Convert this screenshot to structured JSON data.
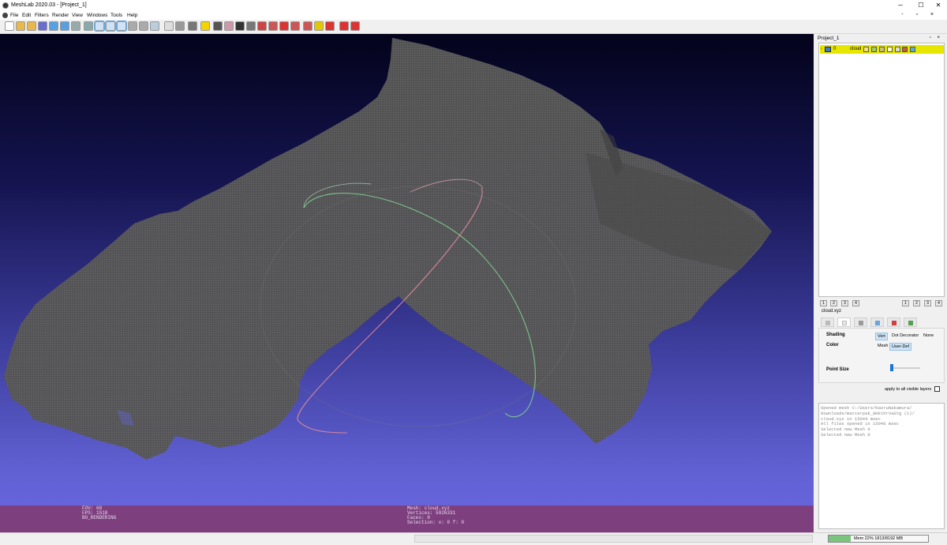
{
  "window": {
    "title": "MeshLab 2020.03 - [Project_1]",
    "minimize": "─",
    "maximize": "☐",
    "close": "✕"
  },
  "menu": {
    "items": [
      "File",
      "Edit",
      "Filters",
      "Render",
      "View",
      "Windows",
      "Tools",
      "Help"
    ],
    "mdi_controls": "- ▫ ×"
  },
  "toolbar_icons": [
    "new-project",
    "open-project",
    "save-project",
    "close-project",
    "import-mesh",
    "export-mesh",
    "reload",
    "snapshot",
    "bbox-mode",
    "points-mode",
    "wireframe-mode",
    "flat-mode",
    "smooth-mode",
    "texture-mode",
    "layers",
    "decorations",
    "trackball",
    "measure",
    "pick-points",
    "manipulators",
    "paint",
    "select-faces",
    "select-vertices",
    "select-connected",
    "delete-faces",
    "delete-vertices",
    "align",
    "info",
    "delete-selected-faces",
    "delete-selected-vertices",
    "delete-selected"
  ],
  "status_left": [
    "FOV: 60",
    "FPS:   1518",
    "BO_RENDERING"
  ],
  "status_center": [
    "Mesh: cloud.xyz",
    "Vertices: 5926331",
    "Faces: 0",
    "Selection: v: 0 f: 0"
  ],
  "panel": {
    "title": "Project_1",
    "controls": "▫ ×",
    "layer": {
      "number": "0",
      "name": "cloud"
    },
    "snap_left": [
      "1",
      "2",
      "3",
      "4"
    ],
    "snap_right": [
      "1",
      "2",
      "3",
      "4"
    ],
    "mesh_file": "cloud.xyz",
    "render": {
      "shading_label": "Shading",
      "shading_options": [
        "Vert",
        "Dot Decorator",
        "None"
      ],
      "color_label": "Color",
      "color_options": [
        "Mesh",
        "User-Def"
      ],
      "point_size_label": "Point Size",
      "point_size_level": 0.05,
      "apply_label": "apply to all visible layers"
    }
  },
  "log": [
    "Opened mesh C:/Users/KaoruNakamura/",
    "Downloads/matterpak_9mkthrVaGYg (1)/",
    "cloud.xyz in 15044 msec",
    "All files opened in 15046 msec",
    "Selected new Mesh 0",
    "Selected new Mesh 0"
  ],
  "memory": {
    "label": "Mem 22% 1813/8192 MB",
    "fraction": 0.22
  },
  "colors": {
    "status_bar": "#7e3f7e",
    "layer_selected": "#e6e600",
    "cloud": "#585858"
  }
}
